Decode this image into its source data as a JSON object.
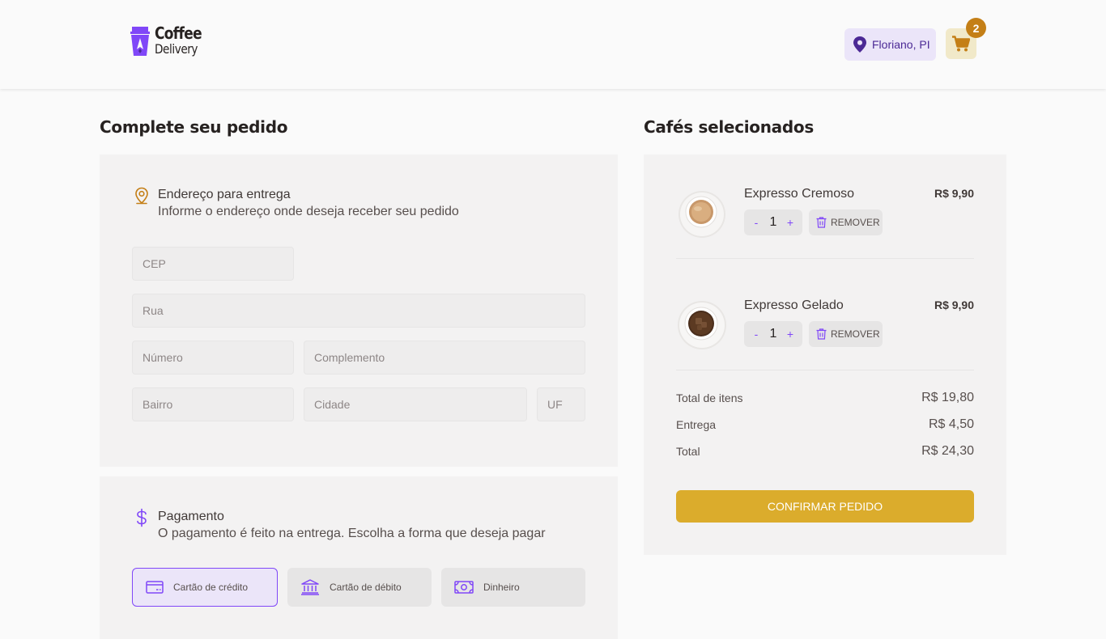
{
  "header": {
    "logo": {
      "line1": "Coffee",
      "line2": "Delivery"
    },
    "location": "Floriano, PI",
    "cart_count": "2"
  },
  "order": {
    "title": "Complete seu pedido",
    "address": {
      "title": "Endereço para entrega",
      "subtitle": "Informe o endereço onde deseja receber seu pedido",
      "fields": {
        "cep": {
          "placeholder": "CEP",
          "value": ""
        },
        "rua": {
          "placeholder": "Rua",
          "value": ""
        },
        "numero": {
          "placeholder": "Número",
          "value": ""
        },
        "complemento": {
          "placeholder": "Complemento",
          "value": ""
        },
        "bairro": {
          "placeholder": "Bairro",
          "value": ""
        },
        "cidade": {
          "placeholder": "Cidade",
          "value": ""
        },
        "uf": {
          "placeholder": "UF",
          "value": ""
        }
      }
    },
    "payment": {
      "title": "Pagamento",
      "subtitle": "O pagamento é feito na entrega. Escolha a forma que deseja pagar",
      "options": [
        {
          "label": "Cartão de crédito",
          "icon": "credit-card-icon",
          "selected": true
        },
        {
          "label": "Cartão de débito",
          "icon": "bank-icon",
          "selected": false
        },
        {
          "label": "Dinheiro",
          "icon": "money-icon",
          "selected": false
        }
      ]
    }
  },
  "cart": {
    "title": "Cafés selecionados",
    "items": [
      {
        "name": "Expresso Cremoso",
        "price": "R$ 9,90",
        "quantity": "1",
        "minus": "-",
        "plus": "+",
        "remove_label": "REMOVER"
      },
      {
        "name": "Expresso Gelado",
        "price": "R$ 9,90",
        "quantity": "1",
        "minus": "-",
        "plus": "+",
        "remove_label": "REMOVER"
      }
    ],
    "summary": {
      "items_label": "Total de itens",
      "items_value": "R$ 19,80",
      "delivery_label": "Entrega",
      "delivery_value": "R$ 4,50",
      "total_label": "Total",
      "total_value": "R$ 24,30"
    },
    "confirm_label": "CONFIRMAR PEDIDO"
  },
  "colors": {
    "purple": "#8047F8",
    "purple_dark": "#4B2995",
    "yellow": "#DBAC2C",
    "yellow_dark": "#C47F17",
    "base_card": "#F3F2F2"
  }
}
